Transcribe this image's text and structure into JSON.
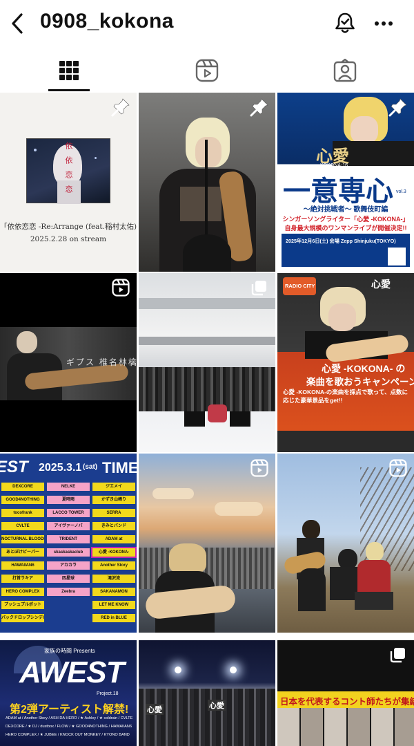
{
  "header": {
    "username": "0908_kokona"
  },
  "tabs": [
    {
      "name": "grid",
      "icon": "grid-icon",
      "active": true
    },
    {
      "name": "reels",
      "icon": "reels-icon",
      "active": false
    },
    {
      "name": "tagged",
      "icon": "tagged-icon",
      "active": false
    }
  ],
  "posts": {
    "p1": {
      "badge": "pin-icon",
      "art_text": "依依恋恋",
      "caption": "「依依恋恋 -Re:Arrange (feat.稲村太佑)」",
      "date": "2025.2.28 on stream"
    },
    "p2": {
      "badge": "pin-icon"
    },
    "p3": {
      "badge": "pin-icon",
      "logo": "心愛",
      "sub": "KOKONA-16",
      "title": "一意専心",
      "vol": "vol.3",
      "subtitle": "～絶対挑戦者～ 歌舞伎町編",
      "line1": "シンガーソングライター「心愛 -KOKONA-」",
      "line2": "自身最大規模のワンマンライブが開催決定!!",
      "venue": "2025年12月6日(土) 会場 Zepp Shinjuku(TOKYO)"
    },
    "p4": {
      "badge": "reels-icon",
      "art_text": "ギプス 椎名林檎"
    },
    "p5": {
      "badge": "carousel-icon"
    },
    "p6": {
      "badge": "",
      "logo1": "RADIO CITY",
      "logo2": "心愛",
      "headline1": "心愛 -KOKONA- の",
      "headline2": "楽曲を歌おうキャンペーン!!",
      "body": "心愛 -KOKONA-の楽曲を採点で歌って、点数に応じた豪華景品をget!!"
    },
    "p7": {
      "badge": "",
      "header_left": "EST",
      "date": "2025.3.1",
      "day": "(sat)",
      "header_right": "TIME TA",
      "col1": [
        "DEXCORE",
        "GOOD4NOTHING",
        "tocofrank",
        "CVLTE",
        "NOCTURNAL BLOODLUST",
        "あとぼけピーパー",
        "HAWAIIAN6",
        "打首ラキア",
        "HERO COMPLEX",
        "プッシュプルポット",
        "バックドロップシンデレラ"
      ],
      "col2": [
        "NELKE",
        "夏時雨",
        "LACCO TOWER",
        "アイヴァーノバ",
        "TRIDENT",
        "skaskaskaclub",
        "アカカラ",
        "四星球",
        "Zeebra"
      ],
      "col3": [
        "ジエメイ",
        "かずき山崎り",
        "SERRA",
        "きみとバンド",
        "ADAM at",
        "心愛 -KOKONA-",
        "Another Story",
        "滝沢流",
        "SAKANAMON",
        "LET ME KNOW",
        "RED in BLUE"
      ]
    },
    "p8": {
      "badge": "reels-icon"
    },
    "p9": {
      "badge": "reels-icon"
    },
    "p10": {
      "badge": "",
      "presents": "家族の時間 Presents",
      "logo": "AWEST",
      "project": "Project.18",
      "headline": "第2弾アーティスト解禁!",
      "lineup1": "ADAM at / Another Story / ASH DA HERO / ★ Ashley / ★ coldrain / CVLTE",
      "lineup2": "DEXCORE / ★ DJ / dustbox / FLOW / ★ GOOD4NOTHING / HAWAIIAN6",
      "lineup3": "HERO COMPLEX / ★ JUBEE / KNOCK OUT MONKEY / KYONO BAND"
    },
    "p11": {
      "badge": "",
      "sign1": "心愛",
      "sign2": "心愛"
    },
    "p12": {
      "badge": "carousel-icon",
      "headline": "日本を代表するコント師たちが集結!"
    }
  }
}
